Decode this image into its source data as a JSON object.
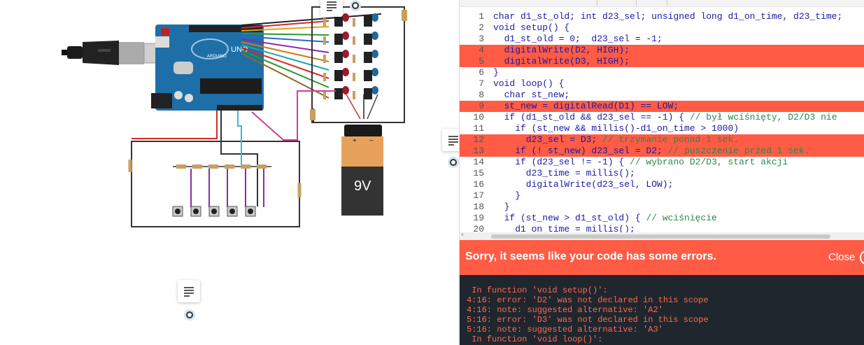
{
  "battery": {
    "label": "9V",
    "plus": "+",
    "minus": "−"
  },
  "arduino": {
    "brand": "UNO",
    "maker": "ARDUINO"
  },
  "colors": {
    "error_accent": "#ff5b45",
    "console_bg": "#1f262e",
    "console_text": "#ff6a4d",
    "code_keyword": "#1a1aa6",
    "code_comment": "#2a8a4a",
    "board": "#1e6fa8",
    "breadboard_wire": "#333333"
  },
  "notes": [
    {
      "icon": "note-lines-icon",
      "pin": "anchor-dot-icon"
    },
    {
      "icon": "note-lines-icon",
      "pin": "anchor-dot-icon"
    },
    {
      "icon": "note-lines-icon",
      "pin": "anchor-dot-icon"
    }
  ],
  "editor": {
    "lines": [
      {
        "num": "1",
        "code": "char d1_st_old; int d23_sel; unsigned long d1_on_time, d23_time;",
        "comment": "",
        "error": false
      },
      {
        "num": "2",
        "code": "void setup() {",
        "comment": "",
        "error": false
      },
      {
        "num": "3",
        "code": "  d1_st_old = 0;  d23_sel = -1;",
        "comment": "",
        "error": false
      },
      {
        "num": "4",
        "code": "  digitalWrite(D2, HIGH);",
        "comment": "",
        "error": true
      },
      {
        "num": "5",
        "code": "  digitalWrite(D3, HIGH);",
        "comment": "",
        "error": true
      },
      {
        "num": "6",
        "code": "}",
        "comment": "",
        "error": false
      },
      {
        "num": "7",
        "code": "void loop() {",
        "comment": "",
        "error": false
      },
      {
        "num": "8",
        "code": "  char st_new;",
        "comment": "",
        "error": false
      },
      {
        "num": "9",
        "code": "  st_new = digitalRead(D1) == LOW;",
        "comment": "",
        "error": true
      },
      {
        "num": "10",
        "code": "  if (d1_st_old && d23_sel == -1) { ",
        "comment": "// był wciśnięty, D2/D3 nie",
        "error": false
      },
      {
        "num": "11",
        "code": "    if (st_new && millis()-d1_on_time > 1000)",
        "comment": "",
        "error": false
      },
      {
        "num": "12",
        "code": "      d23_sel = D3; ",
        "comment": "// trzymanie ponad 1 sek.",
        "error": true
      },
      {
        "num": "13",
        "code": "    if (! st_new) d23_sel = D2; ",
        "comment": "// puszczenie przed 1 sek.",
        "error": true
      },
      {
        "num": "14",
        "code": "    if (d23_sel != -1) { ",
        "comment": "// wybrano D2/D3, start akcji",
        "error": false
      },
      {
        "num": "15",
        "code": "      d23_time = millis();",
        "comment": "",
        "error": false
      },
      {
        "num": "16",
        "code": "      digitalWrite(d23_sel, LOW);",
        "comment": "",
        "error": false
      },
      {
        "num": "17",
        "code": "    }",
        "comment": "",
        "error": false
      },
      {
        "num": "18",
        "code": "  }",
        "comment": "",
        "error": false
      },
      {
        "num": "19",
        "code": "  if (st_new > d1_st_old) { ",
        "comment": "// wciśnięcie",
        "error": false
      },
      {
        "num": "20",
        "code": "    d1_on_time = millis();",
        "comment": "",
        "error": false
      }
    ],
    "scroll_left_icon": "chevron-left-icon"
  },
  "error_bar": {
    "message": "Sorry, it seems like your code has some errors.",
    "close_label": "Close"
  },
  "console": {
    "lines": [
      " In function 'void setup()':",
      "4:16: error: 'D2' was not declared in this scope",
      "4:16: note: suggested alternative: 'A2'",
      "5:16: error: 'D3' was not declared in this scope",
      "5:16: note: suggested alternative: 'A3'",
      " In function 'void loop()':"
    ]
  }
}
